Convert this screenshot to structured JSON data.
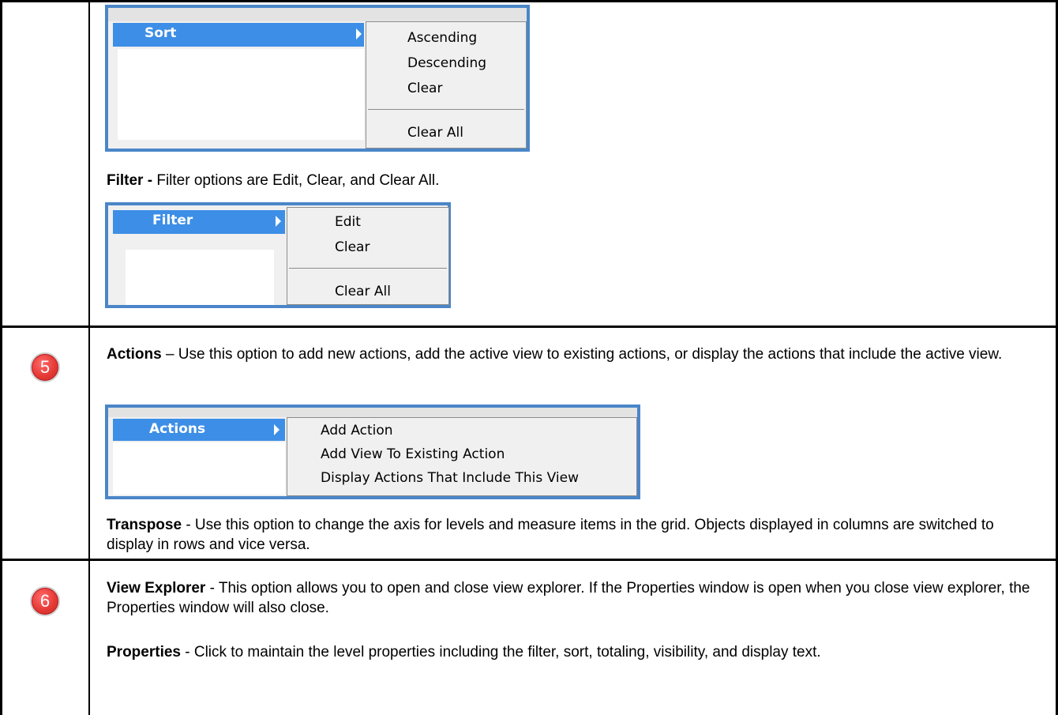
{
  "sort_menu": {
    "label": "Sort",
    "items": [
      "Ascending",
      "Descending",
      "Clear"
    ],
    "clear_all": "Clear All"
  },
  "filter_paragraph": {
    "term": "Filter -",
    "text": " Filter options are Edit, Clear, and Clear All."
  },
  "filter_menu": {
    "label": "Filter",
    "items": [
      "Edit",
      "Clear"
    ],
    "clear_all": "Clear All"
  },
  "row5": {
    "badge": "5",
    "actions_term": "Actions",
    "actions_text": " – Use this option to add new actions, add the active view to existing actions, or display the actions that include the active view.",
    "actions_menu": {
      "label": "Actions",
      "items": [
        "Add Action",
        "Add View To Existing Action",
        "Display Actions That Include This View"
      ]
    },
    "transpose_term": "Transpose",
    "transpose_text": " - Use this option to change the axis for levels and measure items in the grid. Objects displayed in columns are switched to display in rows and vice versa."
  },
  "row6": {
    "badge": "6",
    "view_explorer_term": "View Explorer",
    "view_explorer_text": " - This option allows you to open and close view explorer. If the Properties window is open when you close view explorer, the Properties window will also close.",
    "properties_term": "Properties",
    "properties_text": " - Click to maintain the level properties including the filter, sort, totaling, visibility, and display text."
  },
  "colors": {
    "accent_border": "#4a86c8",
    "menu_highlight": "#3d8ee6",
    "badge_red": "#e53935"
  }
}
